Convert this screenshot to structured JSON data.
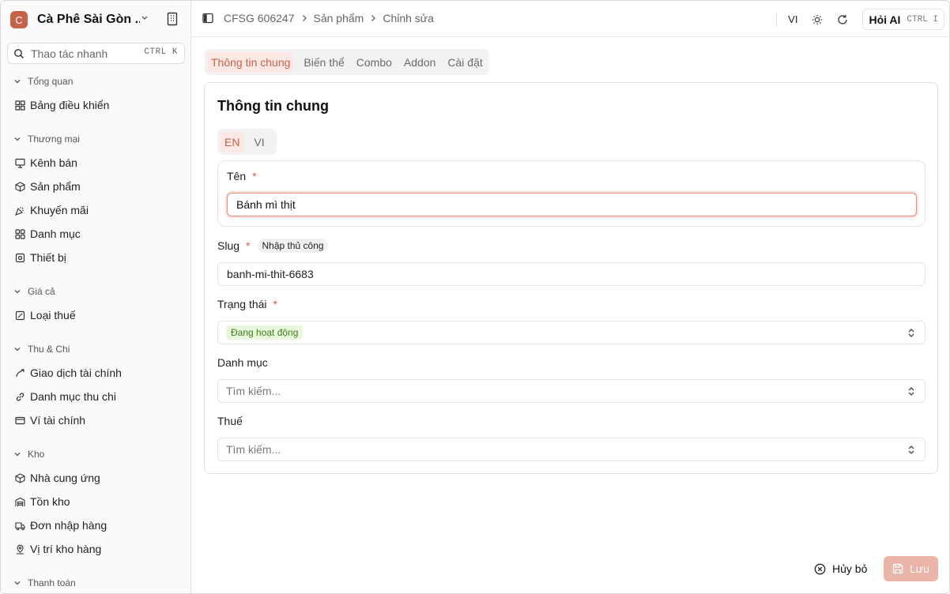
{
  "brand": {
    "logo_letter": "C",
    "name": "Cà Phê Sài Gòn ..."
  },
  "quick_search": {
    "placeholder": "Thao tác nhanh",
    "shortcut": "CTRL K"
  },
  "sidebar": {
    "groups": [
      {
        "label": "Tổng quan",
        "items": [
          {
            "label": "Bảng điều khiển",
            "icon": "dashboard-icon"
          }
        ]
      },
      {
        "label": "Thương mại",
        "items": [
          {
            "label": "Kênh bán",
            "icon": "monitor-icon"
          },
          {
            "label": "Sản phẩm",
            "icon": "box-icon"
          },
          {
            "label": "Khuyến mãi",
            "icon": "party-popper-icon"
          },
          {
            "label": "Danh mục",
            "icon": "grid-icon"
          },
          {
            "label": "Thiết bị",
            "icon": "device-icon"
          }
        ]
      },
      {
        "label": "Giá cả",
        "items": [
          {
            "label": "Loại thuế",
            "icon": "percent-icon"
          }
        ]
      },
      {
        "label": "Thu & Chi",
        "items": [
          {
            "label": "Giao dịch tài chính",
            "icon": "transactions-icon"
          },
          {
            "label": "Danh mục thu chi",
            "icon": "link-icon"
          },
          {
            "label": "Ví tài chính",
            "icon": "wallet-icon"
          }
        ]
      },
      {
        "label": "Kho",
        "items": [
          {
            "label": "Nhà cung ứng",
            "icon": "package-icon"
          },
          {
            "label": "Tồn kho",
            "icon": "warehouse-icon"
          },
          {
            "label": "Đơn nhập hàng",
            "icon": "truck-icon"
          },
          {
            "label": "Vị trí kho hàng",
            "icon": "map-pin-icon"
          }
        ]
      },
      {
        "label": "Thanh toán",
        "items": []
      }
    ]
  },
  "header": {
    "breadcrumbs": [
      "CFSG 606247",
      "Sản phẩm",
      "Chỉnh sửa"
    ],
    "language": "VI",
    "ask_ai": {
      "label": "Hỏi AI",
      "shortcut": "CTRL I"
    }
  },
  "main": {
    "tabs": [
      "Thông tin chung",
      "Biến thể",
      "Combo",
      "Addon",
      "Cài đặt"
    ],
    "active_tab": "Thông tin chung",
    "card_title": "Thông tin chung",
    "lang_tabs": [
      "EN",
      "VI"
    ],
    "active_lang": "EN",
    "fields": {
      "name": {
        "label": "Tên",
        "required": "*",
        "value": "Bánh mì thịt"
      },
      "slug": {
        "label": "Slug",
        "required": "*",
        "tag": "Nhập thủ công",
        "value": "banh-mi-thit-6683"
      },
      "status": {
        "label": "Trạng thái",
        "required": "*",
        "value": "Đang hoạt động"
      },
      "category": {
        "label": "Danh mục",
        "placeholder": "Tìm kiếm..."
      },
      "tax": {
        "label": "Thuế",
        "placeholder": "Tìm kiếm..."
      }
    }
  },
  "footer": {
    "cancel_label": "Hủy bỏ",
    "save_label": "Lưu"
  },
  "colors": {
    "accent": "#c4624a",
    "accent_soft": "#fbe7e3",
    "status_green": "#3e7f1c",
    "save_disabled": "#eab5a8"
  }
}
